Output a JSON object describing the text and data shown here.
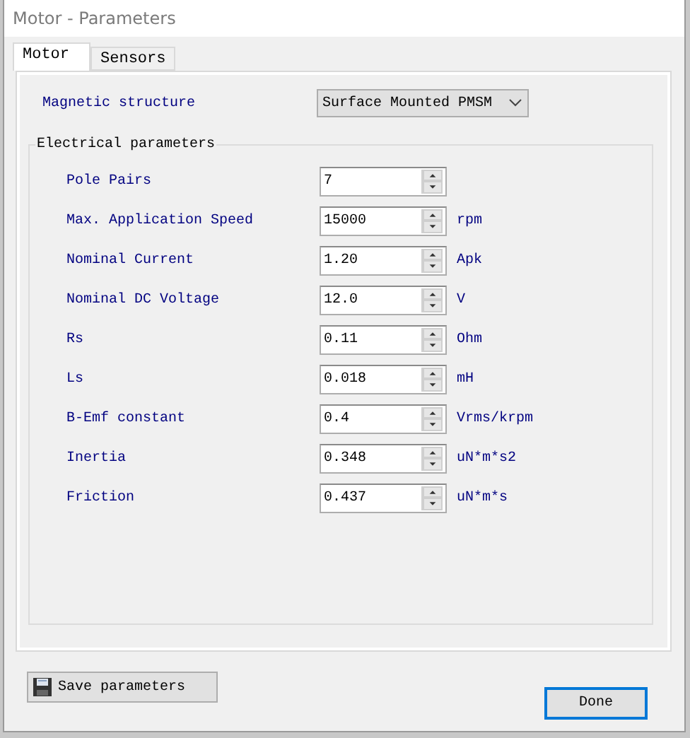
{
  "window": {
    "title": "Motor - Parameters"
  },
  "tabs": [
    {
      "label": "Motor",
      "selected": true
    },
    {
      "label": "Sensors",
      "selected": false
    }
  ],
  "magnetic_structure": {
    "label": "Magnetic structure",
    "value": "Surface Mounted PMSM"
  },
  "electrical_parameters": {
    "title": "Electrical parameters",
    "rows": [
      {
        "label": "Pole Pairs",
        "value": "7"
      },
      {
        "label": "Max. Application Speed",
        "value": "15000",
        "unit": "rpm"
      },
      {
        "label": "Nominal Current",
        "value": "1.20",
        "unit": "Apk"
      },
      {
        "label": "Nominal DC Voltage",
        "value": "12.0",
        "unit": "V"
      },
      {
        "label": "Rs",
        "value": "0.11",
        "unit": "Ohm"
      },
      {
        "label": "Ls",
        "value": "0.018",
        "unit": "mH"
      },
      {
        "label": "B-Emf constant",
        "value": "0.4",
        "unit": "Vrms/krpm"
      },
      {
        "label": "Inertia",
        "value": "0.348",
        "unit": "uN*m*s2"
      },
      {
        "label": "Friction",
        "value": "0.437",
        "unit": "uN*m*s"
      }
    ]
  },
  "buttons": [
    {
      "label": "Save parameters",
      "kind": "save",
      "focused": false
    },
    {
      "label": "Done",
      "kind": "plain",
      "focused": true
    }
  ]
}
